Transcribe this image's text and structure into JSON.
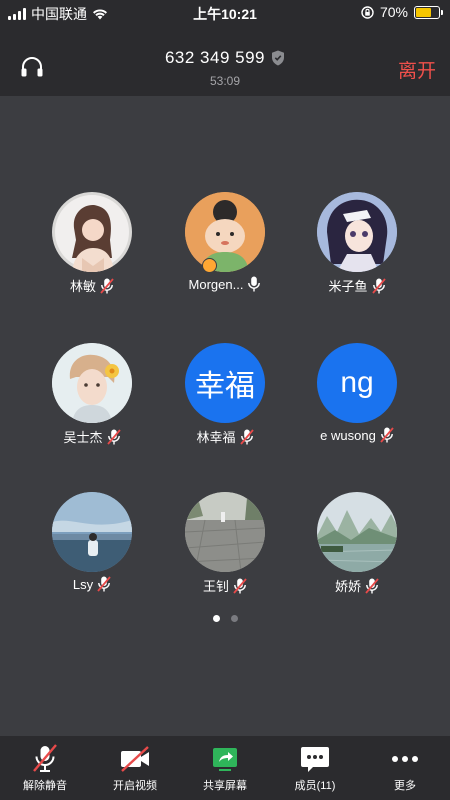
{
  "status_bar": {
    "carrier": "中国联通",
    "time": "上午10:21",
    "battery_percent": "70%",
    "battery_level": 0.7
  },
  "header": {
    "meeting_id": "632 349 599",
    "elapsed": "53:09",
    "leave_label": "离开"
  },
  "participants": [
    {
      "name": "林敏",
      "avatar_text": "",
      "mic": "muted"
    },
    {
      "name": "Morgen...",
      "avatar_text": "",
      "mic": "on",
      "host": true
    },
    {
      "name": "米子鱼",
      "avatar_text": "",
      "mic": "muted"
    },
    {
      "name": "吴士杰",
      "avatar_text": "",
      "mic": "muted"
    },
    {
      "name": "林幸福",
      "avatar_text": "幸福",
      "mic": "muted"
    },
    {
      "name": "e wusong",
      "avatar_text": "ng",
      "mic": "muted"
    },
    {
      "name": "Lsy",
      "avatar_text": "",
      "mic": "muted"
    },
    {
      "name": "王钊",
      "avatar_text": "",
      "mic": "muted"
    },
    {
      "name": "娇娇",
      "avatar_text": "",
      "mic": "muted"
    }
  ],
  "pagination": {
    "pages": 2,
    "current": 1
  },
  "toolbar": {
    "unmute_label": "解除静音",
    "start_video_label": "开启视频",
    "share_screen_label": "共享屏幕",
    "members_label": "成员(11)",
    "more_label": "更多"
  },
  "colors": {
    "accent_blue": "#1a73ef",
    "leave_red": "#f0504b",
    "muted_red": "#e84a4a",
    "share_green": "#2fb55a",
    "battery_yellow": "#f6c600"
  }
}
